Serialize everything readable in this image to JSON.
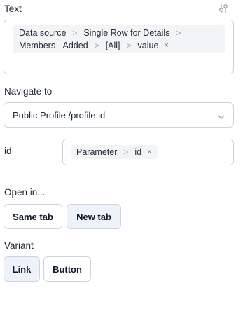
{
  "text_section": {
    "label": "Text",
    "settings_icon": "sliders-icon",
    "line1": [
      "Data source",
      "Single Row for Details"
    ],
    "line2": [
      "Members - Added",
      "[All]",
      "value"
    ],
    "remove_icon": "×"
  },
  "navigate": {
    "label": "Navigate to",
    "value": "Public Profile /profile:id",
    "chevron_icon": "chevron-down-icon"
  },
  "id_param": {
    "label": "id",
    "chip": [
      "Parameter",
      "id"
    ],
    "remove_icon": "×"
  },
  "open_in": {
    "label": "Open in...",
    "options": [
      "Same tab",
      "New tab"
    ],
    "selected": "New tab"
  },
  "variant": {
    "label": "Variant",
    "options": [
      "Link",
      "Button"
    ],
    "selected": "Link"
  },
  "separator": ">"
}
